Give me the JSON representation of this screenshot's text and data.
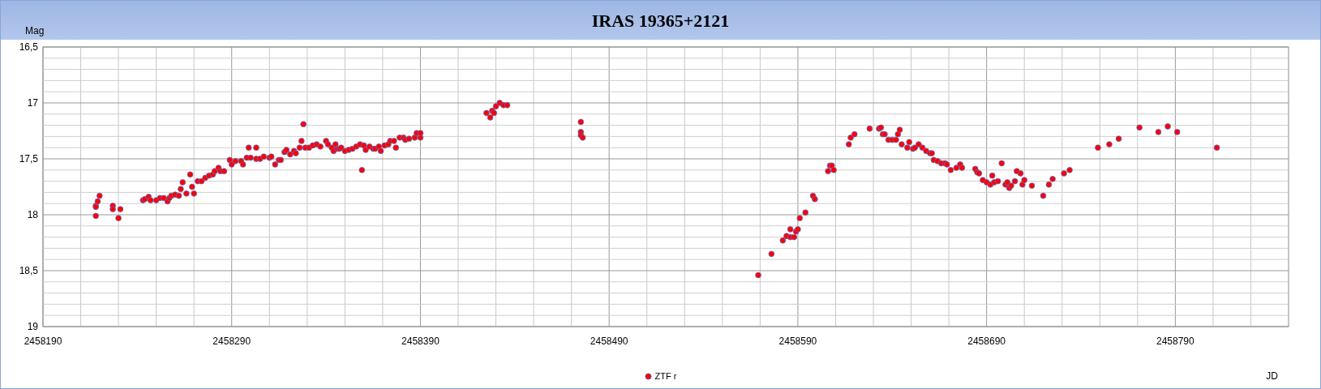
{
  "chart": {
    "chart_data": {
      "type": "scatter",
      "title": "IRAS 19365+2121",
      "xlabel": "JD",
      "ylabel": "Mag",
      "grid": true,
      "xlim": [
        2458190,
        2458850
      ],
      "ylim": [
        19,
        16.5
      ],
      "xticks": [
        2458190,
        2458290,
        2458390,
        2458490,
        2458590,
        2458690,
        2458790
      ],
      "yticks": [
        {
          "value": 16.5,
          "label": "16,5"
        },
        {
          "value": 17,
          "label": "17"
        },
        {
          "value": 17.5,
          "label": "17,5"
        },
        {
          "value": 18,
          "label": "18"
        },
        {
          "value": 18.5,
          "label": "18,5"
        },
        {
          "value": 19,
          "label": "19"
        }
      ],
      "series": [
        {
          "name": "ZTF r",
          "color": "#ff0000",
          "x": [
            2458218,
            2458218,
            2458218,
            2458219,
            2458220,
            2458227,
            2458227,
            2458230,
            2458231,
            2458243,
            2458244,
            2458246,
            2458247,
            2458250,
            2458252,
            2458254,
            2458256,
            2458257,
            2458258,
            2458260,
            2458262,
            2458263,
            2458264,
            2458266,
            2458268,
            2458269,
            2458270,
            2458272,
            2458274,
            2458276,
            2458278,
            2458280,
            2458281,
            2458283,
            2458284,
            2458286,
            2458289,
            2458290,
            2458292,
            2458295,
            2458296,
            2458298,
            2458299,
            2458300,
            2458303,
            2458303,
            2458305,
            2458307,
            2458310,
            2458311,
            2458313,
            2458315,
            2458316,
            2458318,
            2458319,
            2458321,
            2458323,
            2458324,
            2458326,
            2458327,
            2458328,
            2458329,
            2458331,
            2458333,
            2458335,
            2458337,
            2458340,
            2458341,
            2458343,
            2458344,
            2458345,
            2458346,
            2458347,
            2458348,
            2458350,
            2458352,
            2458354,
            2458356,
            2458358,
            2458359,
            2458360,
            2458361,
            2458363,
            2458365,
            2458366,
            2458368,
            2458369,
            2458371,
            2458373,
            2458374,
            2458376,
            2458377,
            2458379,
            2458381,
            2458382,
            2458384,
            2458387,
            2458388,
            2458390,
            2458390,
            2458425,
            2458427,
            2458428,
            2458429,
            2458430,
            2458432,
            2458434,
            2458436,
            2458475,
            2458475,
            2458475,
            2458476,
            2458569,
            2458576,
            2458582,
            2458584,
            2458586,
            2458586,
            2458588,
            2458589,
            2458590,
            2458591,
            2458594,
            2458598,
            2458599,
            2458606,
            2458607,
            2458608,
            2458609,
            2458617,
            2458618,
            2458620,
            2458628,
            2458633,
            2458634,
            2458635,
            2458636,
            2458638,
            2458640,
            2458642,
            2458643,
            2458644,
            2458645,
            2458648,
            2458649,
            2458651,
            2458652,
            2458654,
            2458656,
            2458658,
            2458660,
            2458661,
            2458662,
            2458664,
            2458666,
            2458668,
            2458669,
            2458671,
            2458674,
            2458676,
            2458677,
            2458684,
            2458685,
            2458686,
            2458688,
            2458690,
            2458692,
            2458693,
            2458694,
            2458696,
            2458698,
            2458700,
            2458701,
            2458702,
            2458703,
            2458705,
            2458706,
            2458708,
            2458709,
            2458710,
            2458714,
            2458720,
            2458723,
            2458725,
            2458731,
            2458734,
            2458749,
            2458755,
            2458760,
            2458771,
            2458781,
            2458786,
            2458791,
            2458812
          ],
          "values": [
            17.92,
            17.93,
            18.01,
            17.88,
            17.83,
            17.92,
            17.95,
            18.03,
            17.95,
            17.87,
            17.86,
            17.84,
            17.87,
            17.87,
            17.85,
            17.85,
            17.88,
            17.85,
            17.83,
            17.82,
            17.83,
            17.77,
            17.71,
            17.81,
            17.64,
            17.75,
            17.81,
            17.7,
            17.7,
            17.67,
            17.65,
            17.64,
            17.61,
            17.58,
            17.61,
            17.61,
            17.51,
            17.55,
            17.52,
            17.52,
            17.55,
            17.49,
            17.4,
            17.49,
            17.4,
            17.5,
            17.5,
            17.48,
            17.49,
            17.48,
            17.55,
            17.51,
            17.51,
            17.44,
            17.42,
            17.46,
            17.43,
            17.45,
            17.4,
            17.34,
            17.19,
            17.4,
            17.4,
            17.38,
            17.37,
            17.39,
            17.34,
            17.37,
            17.4,
            17.43,
            17.37,
            17.41,
            17.41,
            17.4,
            17.43,
            17.42,
            17.41,
            17.39,
            17.37,
            17.6,
            17.38,
            17.42,
            17.39,
            17.41,
            17.41,
            17.39,
            17.43,
            17.38,
            17.37,
            17.34,
            17.34,
            17.4,
            17.31,
            17.31,
            17.33,
            17.32,
            17.31,
            17.27,
            17.31,
            17.27,
            17.09,
            17.13,
            17.07,
            17.09,
            17.03,
            17.0,
            17.02,
            17.02,
            17.17,
            17.26,
            17.29,
            17.31,
            18.54,
            18.35,
            18.23,
            18.19,
            18.2,
            18.13,
            18.2,
            18.15,
            18.13,
            18.03,
            17.98,
            17.83,
            17.86,
            17.61,
            17.56,
            17.56,
            17.6,
            17.37,
            17.31,
            17.28,
            17.23,
            17.23,
            17.22,
            17.28,
            17.28,
            17.33,
            17.33,
            17.33,
            17.28,
            17.24,
            17.37,
            17.4,
            17.35,
            17.41,
            17.4,
            17.37,
            17.4,
            17.43,
            17.45,
            17.45,
            17.51,
            17.52,
            17.54,
            17.54,
            17.55,
            17.6,
            17.58,
            17.55,
            17.58,
            17.59,
            17.62,
            17.63,
            17.69,
            17.71,
            17.73,
            17.65,
            17.71,
            17.7,
            17.54,
            17.73,
            17.71,
            17.76,
            17.74,
            17.7,
            17.61,
            17.63,
            17.73,
            17.69,
            17.74,
            17.83,
            17.73,
            17.68,
            17.63,
            17.6,
            17.4,
            17.37,
            17.32,
            17.22,
            17.26,
            17.21,
            17.26,
            17.4
          ]
        }
      ]
    }
  }
}
